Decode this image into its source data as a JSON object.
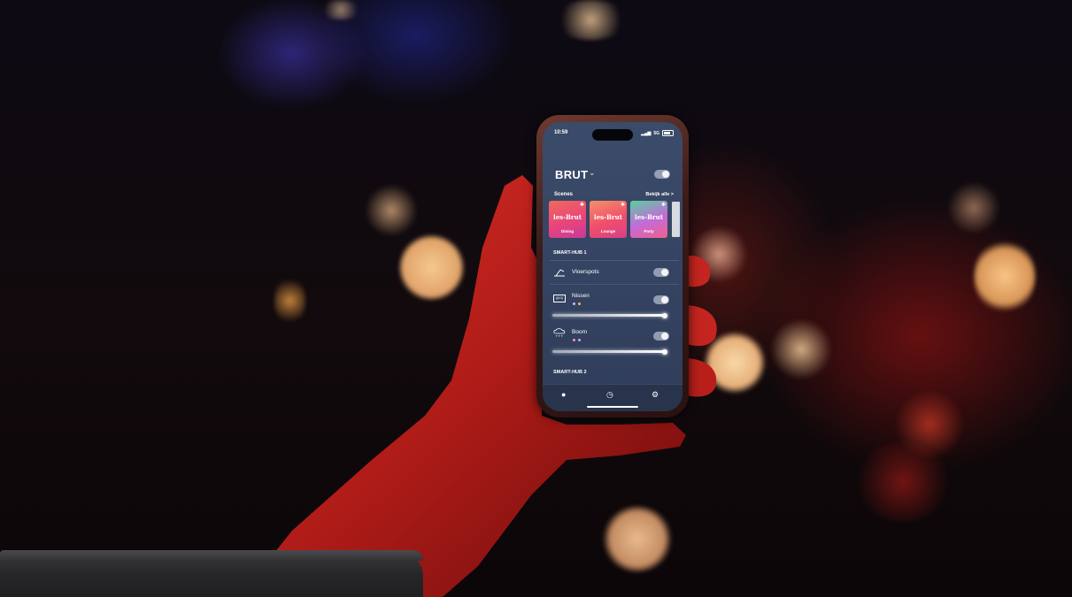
{
  "phone": {
    "status": {
      "time": "10:59",
      "network": "5G"
    },
    "header": {
      "title": "BRUT"
    },
    "scenes": {
      "label": "Scenes",
      "see_all": "Bekijk alle >",
      "cards": [
        {
          "logo": "les-Brut",
          "name": "Dining"
        },
        {
          "logo": "les-Brut",
          "name": "Lounge"
        },
        {
          "logo": "les-Brut",
          "name": "Party"
        }
      ]
    },
    "groups": [
      {
        "title": "SMART-HUB 1"
      },
      {
        "title": "SMART-HUB 2"
      }
    ],
    "rooms": [
      {
        "name": "Vloerspots"
      },
      {
        "name": "Nissen",
        "icon_text": "||ILO|"
      },
      {
        "name": "Boom"
      }
    ]
  },
  "colors": {
    "screen_bg": "#36455f",
    "card_dining": "#e8457a",
    "card_lounge": "#f04f6a",
    "card_party": "#c46ad8"
  },
  "icons": [
    "bulb-icon",
    "clock-icon",
    "gear-icon",
    "chevron-down-icon",
    "star-icon",
    "lamp-icon",
    "cloud-rain-icon"
  ]
}
